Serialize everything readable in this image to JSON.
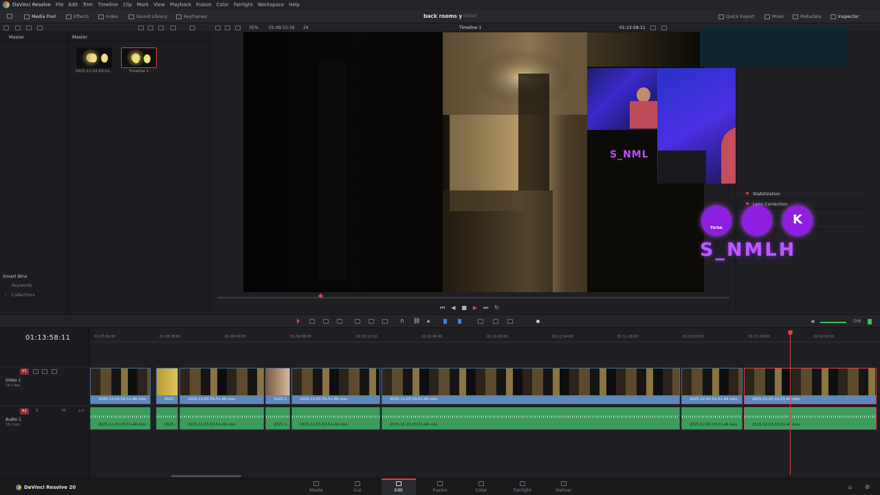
{
  "app": {
    "name": "DaVinci Resolve",
    "menus": [
      "File",
      "Edit",
      "Trim",
      "Timeline",
      "Clip",
      "Mark",
      "View",
      "Playback",
      "Fusion",
      "Color",
      "Fairlight",
      "Workspace",
      "Help"
    ]
  },
  "toolbar": {
    "left_buttons": [
      "Media Pool",
      "Effects",
      "Index",
      "Sound Library",
      "Keyframes"
    ],
    "project_title": "back rooms y",
    "project_status": "Edited",
    "right_buttons": [
      "Quick Export",
      "Mixer",
      "Metadata",
      "Inspector"
    ]
  },
  "subbar": {
    "zoom": "35%",
    "source_timecode": "01:09:15:16",
    "fps": "24",
    "timeline_name": "Timeline 1",
    "viewer_timecode": "01:13:58:11"
  },
  "bins": {
    "header": "Master",
    "smart_bins_title": "Smart Bins",
    "smart_bins": [
      "Keywords",
      "Collections"
    ]
  },
  "media_pool": {
    "header": "Master",
    "clips": [
      {
        "label": "2025-12-03 03-51..."
      },
      {
        "label": "Timeline 1"
      }
    ]
  },
  "overlay": {
    "channel_name": "S_NMLH",
    "small_channel_name": "S_NML",
    "tiktok_label": "TikTok"
  },
  "inspector": {
    "rows": [
      "Stabilization",
      "Lens Correction"
    ]
  },
  "timeline": {
    "timecode": "01:13:58:11",
    "ruler_ticks": [
      "01:07:56:00",
      "01:08:36:00",
      "01:09:04:00",
      "01:09:38:00",
      "01:10:12:00",
      "01:10:46:00",
      "01:11:20:00",
      "01:11:54:00",
      "01:12:28:00",
      "01:13:02:00",
      "01:13:36:00",
      "01:14:10:00"
    ],
    "video_track": {
      "badge": "V1",
      "name": "Video 1",
      "count": "18 Clips"
    },
    "audio_track": {
      "badge": "A1",
      "name": "Audio 1",
      "count": "18 Clips",
      "level": "2.0"
    },
    "clips": [
      {
        "label": "2025-12-03 03-51-46.mkv"
      },
      {
        "label": "2025..."
      },
      {
        "label": "2025-12-03 03-51-46.mkv"
      },
      {
        "label": "2025-1..."
      },
      {
        "label": "2025-12-03 03-51-46.mkv"
      },
      {
        "label": "2025-12-03 03-51-46.mkv"
      },
      {
        "label": "2025-12-03 03-51-46.mkv"
      },
      {
        "label": "2025-12-03 03-51-46.mkv"
      }
    ],
    "dim_label": "DIM"
  },
  "footer": {
    "brand": "DaVinci Resolve 20",
    "pages": [
      "Media",
      "Cut",
      "Edit",
      "Fusion",
      "Color",
      "Fairlight",
      "Deliver"
    ],
    "active_page": "Edit"
  }
}
